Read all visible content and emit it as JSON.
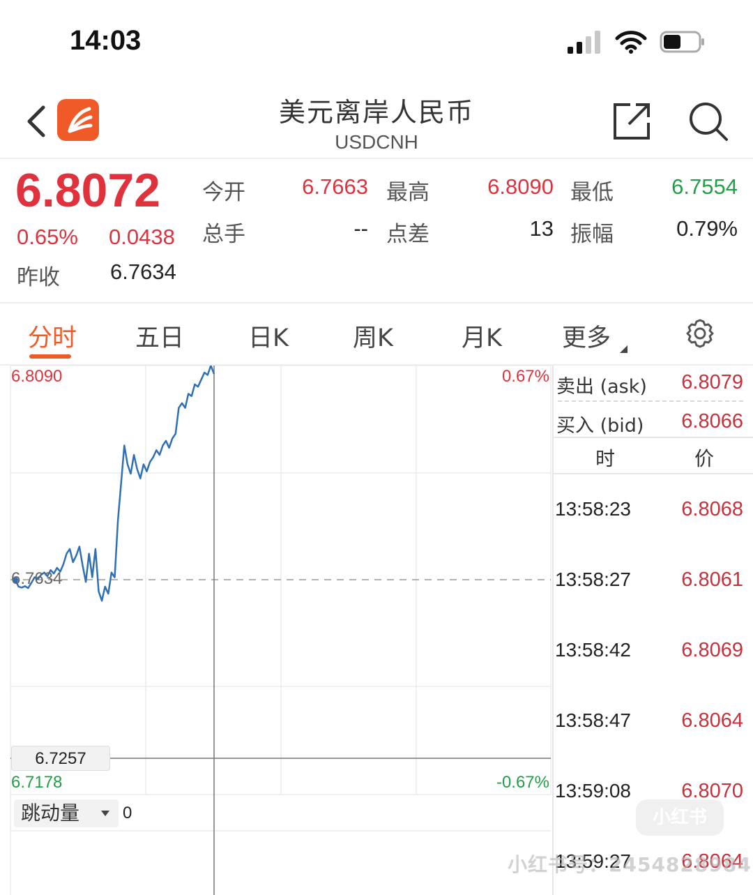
{
  "status_bar": {
    "time": "14:03"
  },
  "header": {
    "title": "美元离岸人民币",
    "subtitle": "USDCNH"
  },
  "quote": {
    "price": "6.8072",
    "change_pct": "0.65%",
    "change_abs": "0.0438",
    "prev_close_label": "昨收",
    "prev_close": "6.7634",
    "open_label": "今开",
    "open": "6.7663",
    "high_label": "最高",
    "high": "6.8090",
    "low_label": "最低",
    "low": "6.7554",
    "volume_label": "总手",
    "volume": "--",
    "spread_label": "点差",
    "spread": "13",
    "amplitude_label": "振幅",
    "amplitude": "0.79%"
  },
  "tabs": [
    "分时",
    "五日",
    "日K",
    "周K",
    "月K",
    "更多"
  ],
  "chart": {
    "top_price": "6.8090",
    "top_pct": "0.67%",
    "mid_price": "6.7634",
    "bottom_price": "6.7178",
    "bottom_pct": "-0.67%",
    "crosshair_price": "6.7257",
    "indicator_select": "跳动量",
    "indicator_value": "0"
  },
  "chart_data": {
    "type": "line",
    "series": [
      {
        "values": [
          6.7634,
          6.762,
          6.7618,
          6.7621,
          6.7617,
          6.7628,
          6.764,
          6.7636,
          6.7645,
          6.765,
          6.7642,
          6.7655,
          6.7648,
          6.766,
          6.7652,
          6.7668,
          6.769,
          6.77,
          6.7672,
          6.7686,
          6.7705,
          6.7665,
          6.763,
          6.769,
          6.764,
          6.77,
          6.761,
          6.759,
          6.762,
          6.7605,
          6.765,
          6.764,
          6.776,
          6.784,
          6.792,
          6.788,
          6.786,
          6.79,
          6.787,
          6.785,
          6.788,
          6.7865,
          6.7885,
          6.7895,
          6.791,
          6.79,
          6.792,
          6.793,
          6.7915,
          6.7935,
          6.7945,
          6.8,
          6.801,
          6.8,
          6.803,
          6.8025,
          6.805,
          6.8045,
          6.806,
          6.8075,
          6.807,
          6.809,
          6.8072
        ]
      }
    ],
    "ylim": [
      6.7178,
      6.809
    ],
    "reference_line": 6.7634,
    "grid": true
  },
  "order_book": {
    "ask_label": "卖出 (ask)",
    "ask": "6.8079",
    "bid_label": "买入 (bid)",
    "bid": "6.8066",
    "time_header": "时",
    "price_header": "价",
    "ticks": [
      {
        "time": "13:58:23",
        "price": "6.8068"
      },
      {
        "time": "13:58:27",
        "price": "6.8061"
      },
      {
        "time": "13:58:42",
        "price": "6.8069"
      },
      {
        "time": "13:58:47",
        "price": "6.8064"
      },
      {
        "time": "13:59:08",
        "price": "6.8070"
      },
      {
        "time": "13:59:27",
        "price": "6.8064"
      }
    ]
  },
  "watermark": {
    "brand": "小红书",
    "id": "小红书号：2454828984"
  },
  "colors": {
    "up": "#e0323c",
    "down": "#21a045",
    "accent": "#f05a28",
    "line": "#2f6fb5"
  }
}
